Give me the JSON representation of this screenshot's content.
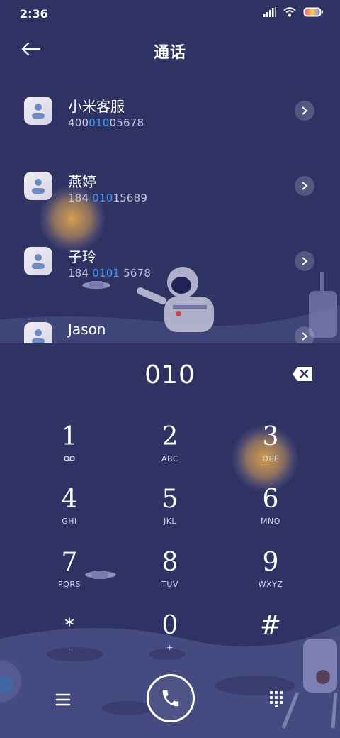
{
  "status_bar": {
    "time": "2:36",
    "icons": [
      "signal-icon",
      "wifi-icon",
      "battery-icon"
    ]
  },
  "header": {
    "title": "通话",
    "back_icon": "arrow-left-icon"
  },
  "contacts": [
    {
      "name": "小米客服",
      "num_pre": "400",
      "num_hl": "010",
      "num_post": "05678"
    },
    {
      "name": "燕婷",
      "num_pre": "184 ",
      "num_hl": "010",
      "num_post": "15689"
    },
    {
      "name": "子玲",
      "num_pre": "184 ",
      "num_hl": "0101",
      "num_post": " 5678"
    },
    {
      "name": "Jason",
      "num_pre": "",
      "num_hl": "",
      "num_post": ""
    }
  ],
  "dialer": {
    "input": "010",
    "keys": [
      {
        "digit": "1",
        "letters": "∞"
      },
      {
        "digit": "2",
        "letters": "ABC"
      },
      {
        "digit": "3",
        "letters": "DEF"
      },
      {
        "digit": "4",
        "letters": "GHI"
      },
      {
        "digit": "5",
        "letters": "JKL"
      },
      {
        "digit": "6",
        "letters": "MNO"
      },
      {
        "digit": "7",
        "letters": "PQRS"
      },
      {
        "digit": "8",
        "letters": "TUV"
      },
      {
        "digit": "9",
        "letters": "WXYZ"
      },
      {
        "digit": "*",
        "letters": ","
      },
      {
        "digit": "0",
        "letters": "+"
      },
      {
        "digit": "#",
        "letters": ""
      }
    ]
  },
  "colors": {
    "background": "#2f3364",
    "highlight": "#3d9bff",
    "accent_glow": "#f0b34a"
  }
}
